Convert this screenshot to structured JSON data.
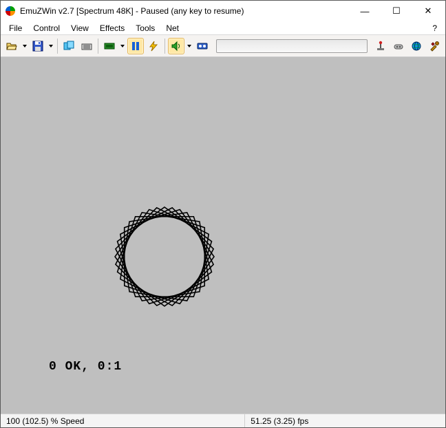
{
  "window": {
    "title": "EmuZWin v2.7 [Spectrum 48K] - Paused (any key to resume)",
    "minimize_glyph": "—",
    "maximize_glyph": "☐",
    "close_glyph": "✕"
  },
  "menubar": {
    "items": [
      "File",
      "Control",
      "View",
      "Effects",
      "Tools",
      "Net"
    ],
    "help_label": "?"
  },
  "toolbar": {
    "buttons": [
      {
        "name": "open-icon",
        "title": "Open"
      },
      {
        "name": "dropdown-icon",
        "title": "Open menu"
      },
      {
        "name": "save-icon",
        "title": "Save"
      },
      {
        "name": "dropdown-icon",
        "title": "Save menu"
      },
      {
        "sep": true
      },
      {
        "name": "copy-icon",
        "title": "Copy screen"
      },
      {
        "name": "keyboard-icon",
        "title": "Keyboard"
      },
      {
        "sep": true
      },
      {
        "name": "device-icon",
        "title": "Machine"
      },
      {
        "name": "dropdown-icon",
        "title": "Machine menu"
      },
      {
        "name": "pause-icon",
        "title": "Pause",
        "active": true
      },
      {
        "name": "flash-icon",
        "title": "Speed"
      },
      {
        "sep": true
      },
      {
        "name": "speaker-icon",
        "title": "Sound",
        "active": true
      },
      {
        "name": "dropdown-icon",
        "title": "Sound menu"
      },
      {
        "name": "tape-icon",
        "title": "Tape"
      }
    ],
    "textbox_value": "",
    "right_buttons": [
      {
        "name": "joystick-icon",
        "title": "Joystick"
      },
      {
        "name": "kempston-icon",
        "title": "Kempston"
      },
      {
        "name": "globe-icon",
        "title": "Net"
      },
      {
        "name": "tools-icon",
        "title": "Tools"
      }
    ]
  },
  "content": {
    "spectrum_status": "0 OK, 0:1"
  },
  "statusbar": {
    "speed": "100 (102.5) % Speed",
    "fps": "51.25 (3.25) fps"
  }
}
